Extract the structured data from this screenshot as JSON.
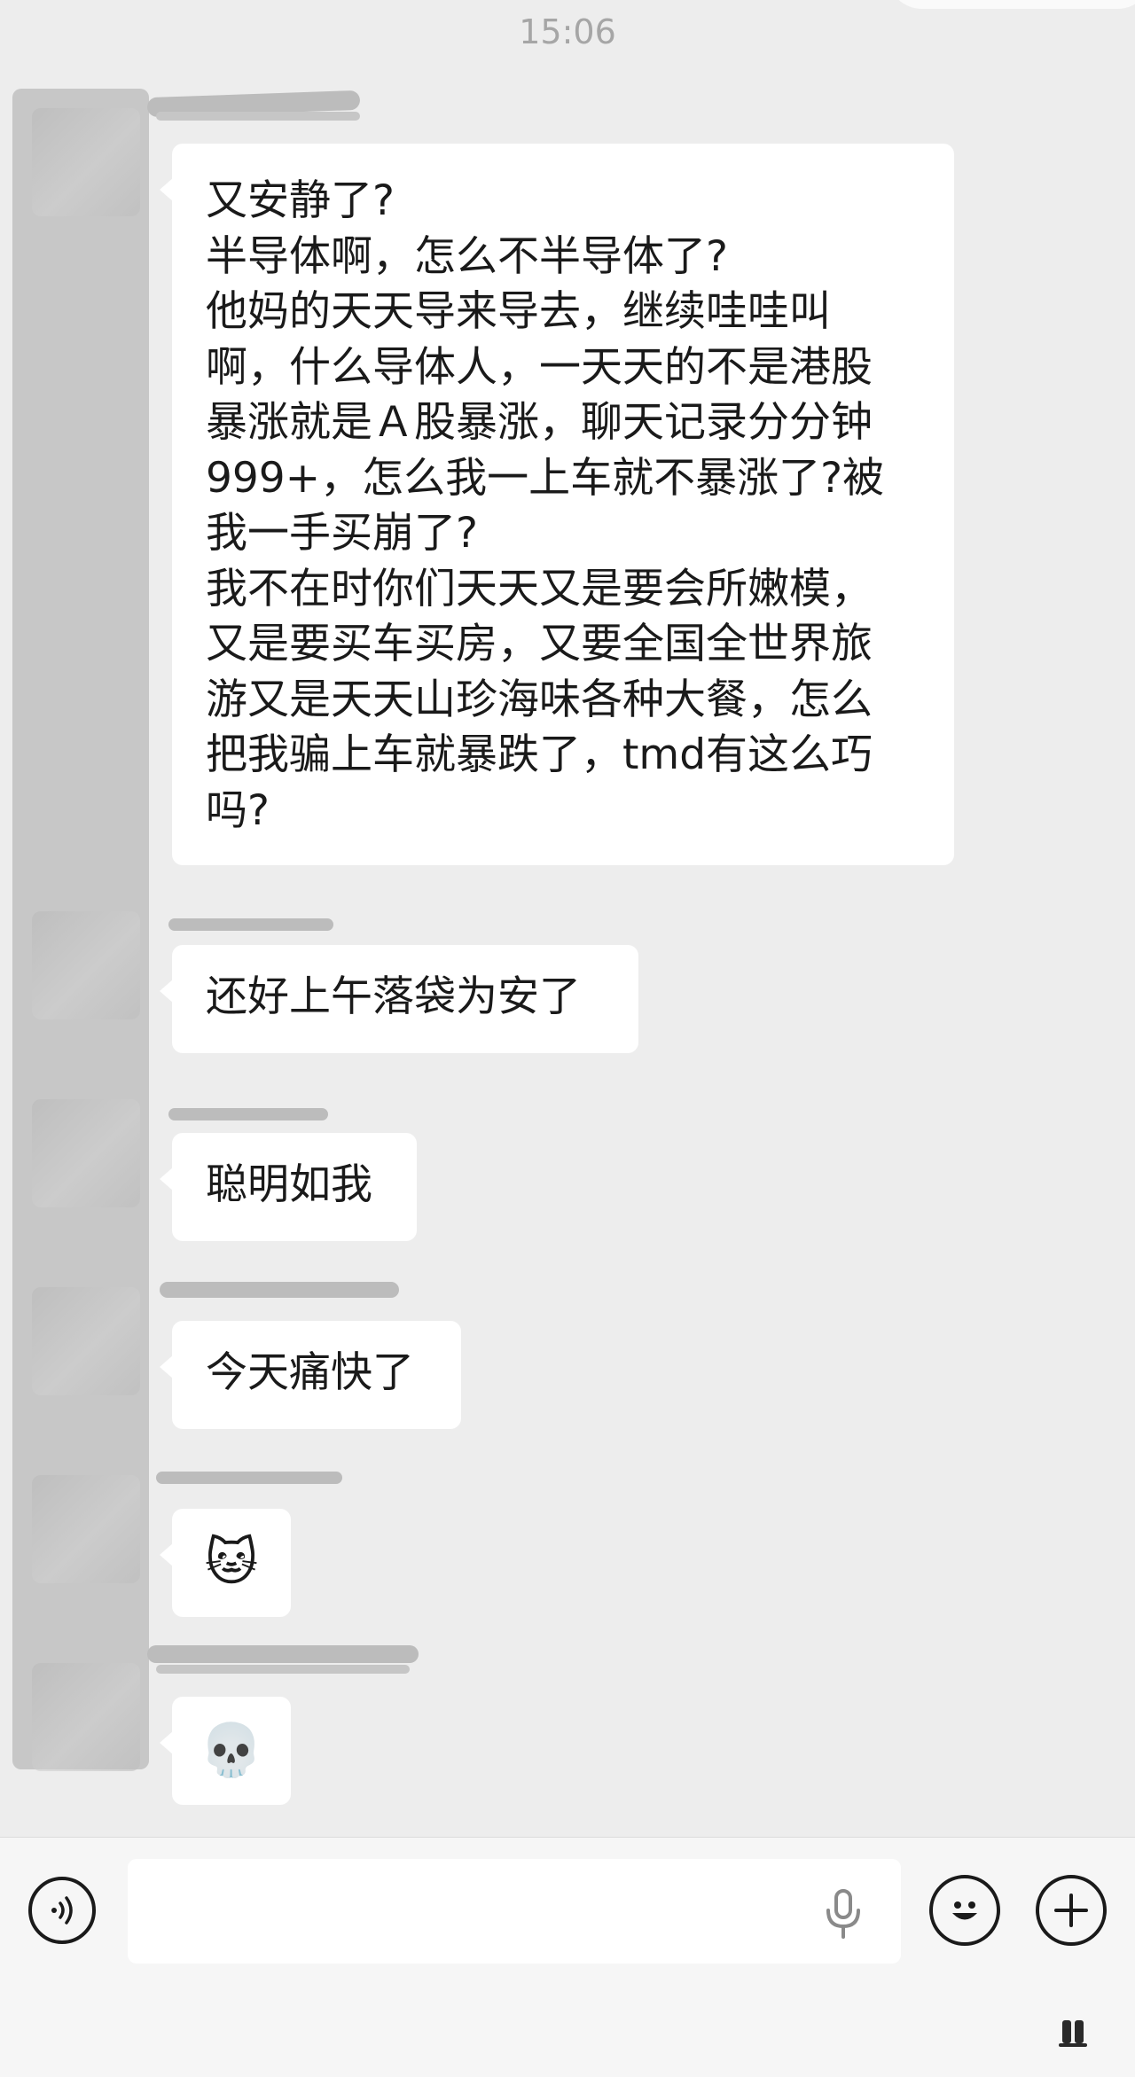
{
  "chat": {
    "timestamp": "15:06",
    "messages": [
      {
        "lines": [
          "又安静了?",
          "半导体啊，怎么不半导体了?",
          "他妈的天天导来导去，继续哇哇叫",
          "啊，什么导体人，一天天的不是港股",
          "暴涨就是Ａ股暴涨，聊天记录分分钟",
          "999+，怎么我一上车就不暴涨了?被",
          "我一手买崩了?",
          "我不在时你们天天又是要会所嫩模，",
          "又是要买车买房，又要全国全世界旅",
          "游又是天天山珍海味各种大餐，怎么",
          "把我骗上车就暴跌了，tmd有这么巧",
          "吗?"
        ]
      },
      {
        "text": "还好上午落袋为安了"
      },
      {
        "text": "聪明如我"
      },
      {
        "text": "今天痛快了"
      },
      {
        "emoji": "🐱"
      },
      {
        "emoji": "💀"
      }
    ]
  },
  "input_bar": {
    "voice_icon": "voice-wave-icon",
    "mic_icon": "microphone-icon",
    "emoji_icon": "smiley-face-icon",
    "plus_icon": "plus-circle-icon"
  }
}
